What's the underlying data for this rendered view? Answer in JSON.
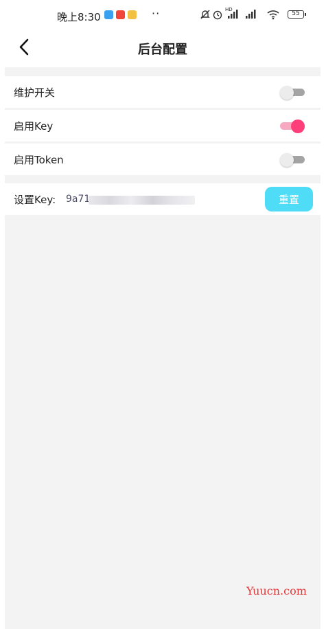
{
  "status_bar": {
    "time": "晚上8:30",
    "dots": "··",
    "signal_hd": "HD",
    "battery": "55"
  },
  "header": {
    "back_icon": "chevron-left-icon",
    "title": "后台配置"
  },
  "settings": {
    "maintenance": {
      "label": "维护开关",
      "on": false
    },
    "enable_key": {
      "label": "启用Key",
      "on": true
    },
    "enable_token": {
      "label": "启用Token",
      "on": false
    }
  },
  "key_row": {
    "label": "设置Key:",
    "value": "9a71.",
    "reset_label": "重置"
  },
  "watermark": "Yuucn.com",
  "colors": {
    "switch_on": "#fe3f79",
    "button": "#4fdcf7",
    "background": "#f3f3f3"
  }
}
